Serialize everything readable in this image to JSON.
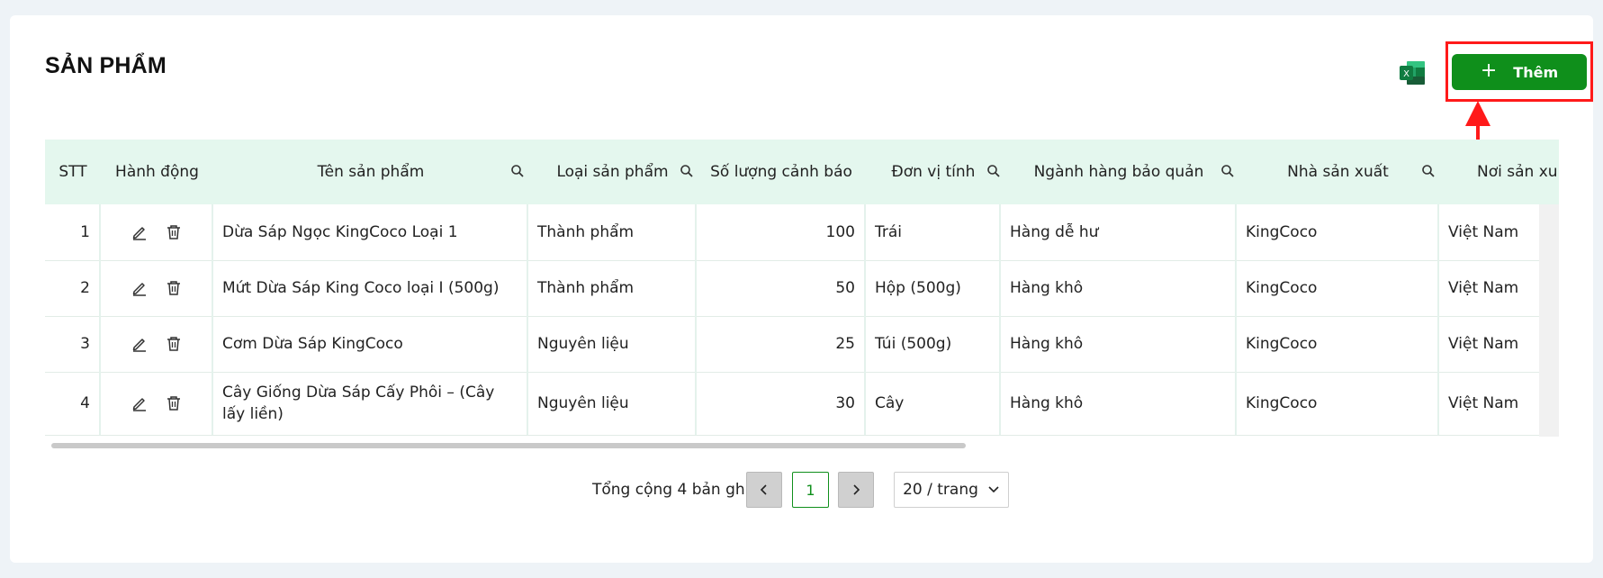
{
  "page": {
    "title": "SẢN PHẨM",
    "add_label": "Thêm",
    "excel_icon": "excel-icon",
    "accent": "#0f8f1b",
    "highlight": "#ff1a1a"
  },
  "table": {
    "headers": {
      "stt": "STT",
      "action": "Hành động",
      "name": "Tên sản phẩm",
      "type": "Loại sản phẩm",
      "qty": "Số lượng cảnh báo",
      "unit": "Đơn vị tính",
      "category": "Ngành hàng bảo quản",
      "maker": "Nhà sản xuất",
      "origin": "Nơi sản xu"
    },
    "rows": [
      {
        "stt": "1",
        "name": "Dừa Sáp Ngọc KingCoco Loại 1",
        "type": "Thành phẩm",
        "qty": "100",
        "unit": "Trái",
        "category": "Hàng dễ hư",
        "maker": "KingCoco",
        "origin": "Việt Nam"
      },
      {
        "stt": "2",
        "name": "Mứt Dừa Sáp King Coco loại I (500g)",
        "type": "Thành phẩm",
        "qty": "50",
        "unit": "Hộp (500g)",
        "category": "Hàng khô",
        "maker": "KingCoco",
        "origin": "Việt Nam"
      },
      {
        "stt": "3",
        "name": "Cơm Dừa Sáp KingCoco",
        "type": "Nguyên liệu",
        "qty": "25",
        "unit": "Túi (500g)",
        "category": "Hàng khô",
        "maker": "KingCoco",
        "origin": "Việt Nam"
      },
      {
        "stt": "4",
        "name": "Cây Giống Dừa Sáp Cấy Phôi – (Cây lấy liền)",
        "type": "Nguyên liệu",
        "qty": "30",
        "unit": "Cây",
        "category": "Hàng khô",
        "maker": "KingCoco",
        "origin": "Việt Nam"
      }
    ]
  },
  "pagination": {
    "total": "Tổng cộng 4 bản ghi",
    "current": "1",
    "page_size": "20 / trang"
  }
}
